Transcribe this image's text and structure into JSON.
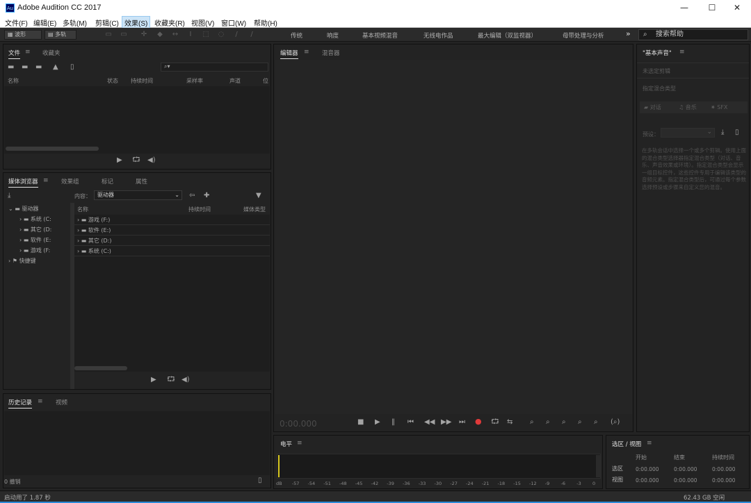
{
  "titlebar": {
    "app_icon": "Au",
    "title": "Adobe Audition CC 2017",
    "minimize": "—",
    "maximize": "☐",
    "close": "✕"
  },
  "menu": [
    "文件(F)",
    "编辑(E)",
    "多轨(M)",
    "剪辑(C)",
    "效果(S)",
    "收藏夹(R)",
    "视图(V)",
    "窗口(W)",
    "帮助(H)"
  ],
  "toolbar": {
    "waveform": "波形",
    "multitrack": "多轨"
  },
  "workspaces": [
    "传统",
    "响度",
    "基本视频混音",
    "无线电作品",
    "最大编辑（双监视器）",
    "母带处理与分析"
  ],
  "workspace_more": "»",
  "search_help": "搜索帮助",
  "files_panel": {
    "tabs": [
      "文件",
      "收藏夹"
    ],
    "search_prefix": "⌕▾",
    "columns": [
      "名称",
      "状态",
      "持续时间",
      "采样率",
      "声道",
      "位"
    ]
  },
  "media_panel": {
    "tabs": [
      "媒体浏览器",
      "效果组",
      "标记",
      "属性"
    ],
    "content_label": "内容：",
    "content_value": "驱动器",
    "tree": [
      {
        "label": "驱动器",
        "level": 0,
        "expanded": true
      },
      {
        "label": "系统 (C:",
        "level": 1
      },
      {
        "label": "其它 (D:",
        "level": 1
      },
      {
        "label": "软件 (E:",
        "level": 1
      },
      {
        "label": "游戏 (F:",
        "level": 1
      },
      {
        "label": "快捷键",
        "level": 0,
        "expanded": false
      }
    ],
    "columns": [
      "名称",
      "持续时间",
      "媒体类型"
    ],
    "rows": [
      "游戏 (F:)",
      "软件 (E:)",
      "其它 (D:)",
      "系统 (C:)"
    ]
  },
  "history_panel": {
    "tabs": [
      "历史记录",
      "视频"
    ],
    "undo_count": "0 撤销"
  },
  "editor_panel": {
    "tabs": [
      "编辑器",
      "混音器"
    ],
    "timecode": "0:00.000"
  },
  "level_panel": {
    "title": "电平",
    "scale": [
      "dB",
      "-57",
      "-54",
      "-51",
      "-48",
      "-45",
      "-42",
      "-39",
      "-36",
      "-33",
      "-30",
      "-27",
      "-24",
      "-21",
      "-18",
      "-15",
      "-12",
      "-9",
      "-6",
      "-3",
      "0"
    ]
  },
  "selection_panel": {
    "title": "选区 / 视图",
    "columns": [
      "开始",
      "结束",
      "持续时间"
    ],
    "rows": [
      {
        "label": "选区",
        "values": [
          "0:00.000",
          "0:00.000",
          "0:00.000"
        ]
      },
      {
        "label": "视图",
        "values": [
          "0:00.000",
          "0:00.000",
          "0:00.000"
        ]
      }
    ]
  },
  "essential_sound": {
    "title": "\"基本声音\"",
    "no_clip": "未选定剪辑",
    "mix_type": "指定混合类型",
    "types": [
      "对话",
      "音乐",
      "SFX"
    ],
    "preset_label": "预设：",
    "help_text": "在多轨会话中选择一个或多个剪辑。使用上面的混合类型选择器指定混合类型（对话、音乐、声音效果或环境）。指定混合类型会显示一组目标控件，这些控件专用于编辑该类型的音频元素。指定混合类型后，可通过每个参数选择预设或步骤来自定义您的混音。"
  },
  "status": {
    "left": "启动用了 1.87 秒",
    "right": "62.43 GB 空闲"
  }
}
